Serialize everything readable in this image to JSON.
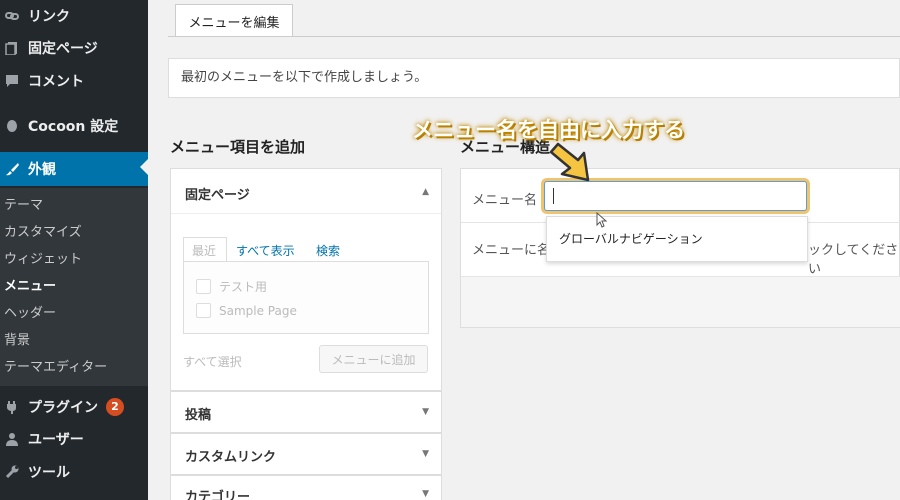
{
  "sidebar": {
    "items": [
      {
        "label": "リンク",
        "icon": "link-icon"
      },
      {
        "label": "固定ページ",
        "icon": "page-icon"
      },
      {
        "label": "コメント",
        "icon": "comment-icon"
      },
      {
        "label": "Cocoon 設定",
        "icon": "cocoon-icon"
      },
      {
        "label": "外観",
        "icon": "paintbrush-icon"
      },
      {
        "label": "プラグイン",
        "icon": "plugin-icon",
        "badge": "2"
      },
      {
        "label": "ユーザー",
        "icon": "user-icon"
      },
      {
        "label": "ツール",
        "icon": "wrench-icon"
      }
    ],
    "submenu": [
      "テーマ",
      "カスタマイズ",
      "ウィジェット",
      "メニュー",
      "ヘッダー",
      "背景",
      "テーマエディター"
    ],
    "current_submenu": "メニュー"
  },
  "main": {
    "tab_label": "メニューを編集",
    "notice": "最初のメニューを以下で作成しましょう。",
    "left_heading": "メニュー項目を追加",
    "right_heading": "メニュー構造",
    "pages_panel": {
      "title": "固定ページ",
      "tabs": [
        "最近",
        "すべて表示",
        "検索"
      ],
      "items": [
        "テスト用",
        "Sample Page"
      ],
      "select_all": "すべて選択",
      "add_button": "メニューに追加"
    },
    "accordions": [
      "投稿",
      "カスタムリンク",
      "カテゴリー"
    ],
    "menu_name_label": "メニュー名",
    "menu_name_value": "",
    "autocomplete_suggestion": "グローバルナビゲーション",
    "menu_help_text_start": "メニューに名",
    "menu_help_text_end": "ックしてください"
  },
  "annotation": "メニュー名を自由に入力する",
  "colors": {
    "sidebar_bg": "#23282d",
    "active": "#0073aa",
    "highlight": "#f0c36d",
    "badge": "#d54e21"
  }
}
